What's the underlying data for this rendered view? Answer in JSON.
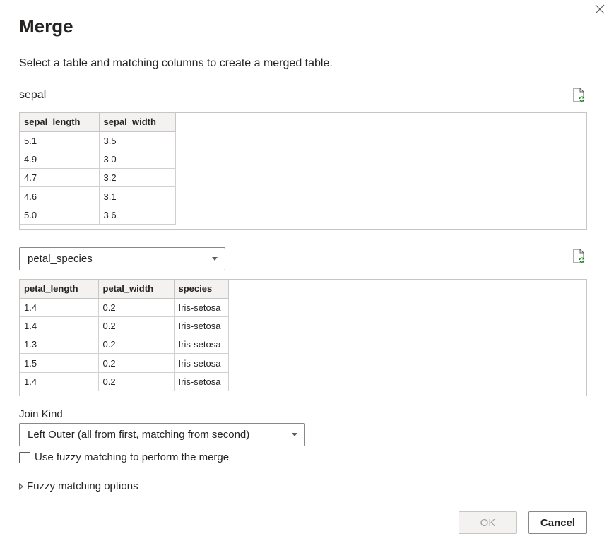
{
  "dialog": {
    "title": "Merge",
    "subtitle": "Select a table and matching columns to create a merged table."
  },
  "first_table": {
    "name": "sepal",
    "columns": [
      "sepal_length",
      "sepal_width"
    ],
    "rows": [
      [
        "5.1",
        "3.5"
      ],
      [
        "4.9",
        "3.0"
      ],
      [
        "4.7",
        "3.2"
      ],
      [
        "4.6",
        "3.1"
      ],
      [
        "5.0",
        "3.6"
      ]
    ]
  },
  "second_table": {
    "selected": "petal_species",
    "columns": [
      "petal_length",
      "petal_width",
      "species"
    ],
    "rows": [
      [
        "1.4",
        "0.2",
        "Iris-setosa"
      ],
      [
        "1.4",
        "0.2",
        "Iris-setosa"
      ],
      [
        "1.3",
        "0.2",
        "Iris-setosa"
      ],
      [
        "1.5",
        "0.2",
        "Iris-setosa"
      ],
      [
        "1.4",
        "0.2",
        "Iris-setosa"
      ]
    ]
  },
  "join": {
    "label": "Join Kind",
    "selected": "Left Outer (all from first, matching from second)"
  },
  "fuzzy": {
    "checkbox_label": "Use fuzzy matching to perform the merge",
    "checked": false,
    "options_label": "Fuzzy matching options"
  },
  "buttons": {
    "ok": "OK",
    "cancel": "Cancel"
  },
  "icons": {
    "close": "close-icon",
    "refresh": "refresh-document-icon",
    "dropdown": "chevron-down-icon",
    "expand": "expand-triangle-icon"
  },
  "colors": {
    "border": "#c8c6c4",
    "header_bg": "#f3f2f1",
    "text": "#252423",
    "disabled_text": "#a19f9d",
    "refresh_green": "#107c10"
  }
}
